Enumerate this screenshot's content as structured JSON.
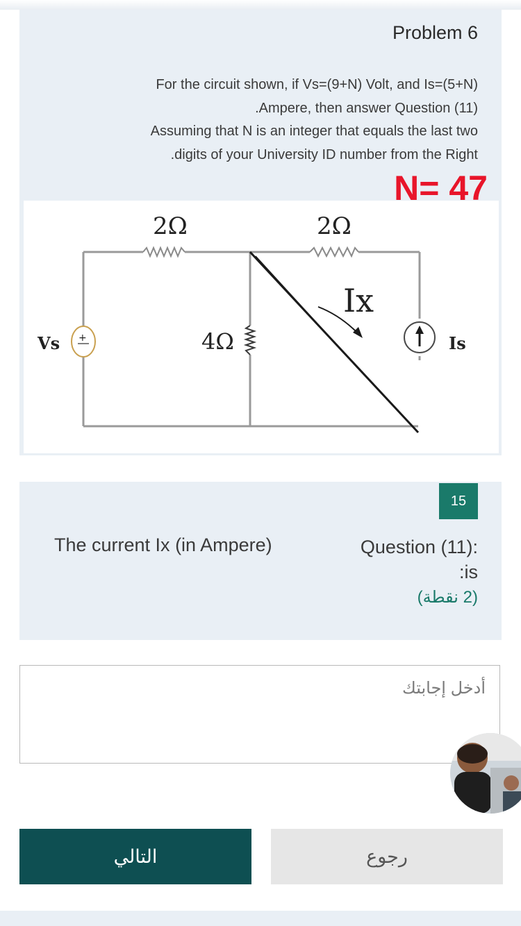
{
  "problem": {
    "title": "Problem 6",
    "text_lines": [
      "For the circuit shown, if Vs=(9+N) Volt, and Is=(5+N)",
      ".Ampere, then answer Question (11)",
      "Assuming that N is an integer that equals the last two",
      ".digits of your University ID number from the Right"
    ],
    "n_value": "N= 47"
  },
  "circuit": {
    "r_top_left": "2Ω",
    "r_top_right": "2Ω",
    "r_middle": "4Ω",
    "current_label": "Ix",
    "source_v": "Vs",
    "source_i": "Is",
    "plus_sign": "+"
  },
  "question": {
    "points_badge": "15",
    "label_line1": "Question (11):",
    "label_line2": ":is",
    "points": "(2 نقطة)",
    "text": "The current Ix (in Ampere)"
  },
  "answer": {
    "placeholder": "أدخل إجابتك"
  },
  "buttons": {
    "next": "التالي",
    "back": "رجوع"
  },
  "colors": {
    "accent": "#0e4f52",
    "badge": "#1a7a6a",
    "highlight": "#e8152a"
  }
}
